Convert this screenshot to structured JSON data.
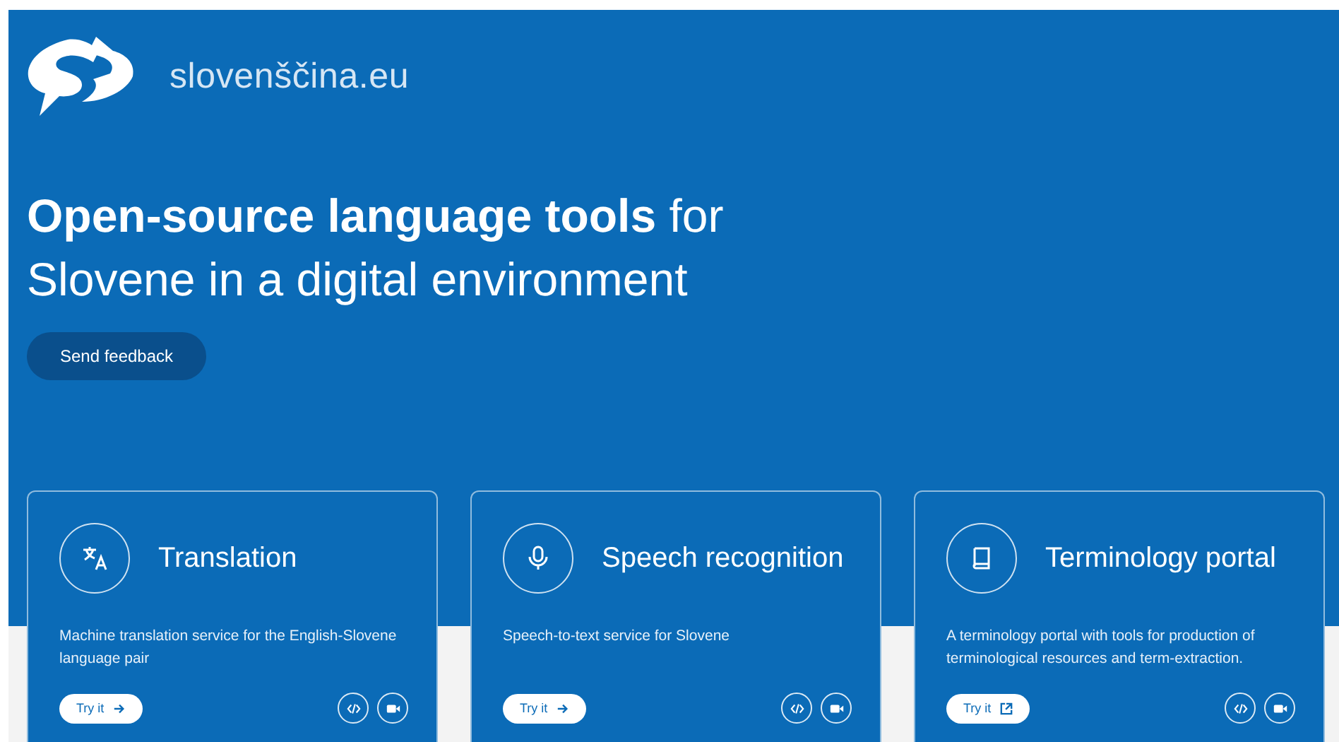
{
  "brand": {
    "name": "slovenščina.eu"
  },
  "hero": {
    "headline": "**Open-source language tools** for Slovene in a digital environment",
    "button": "Send feedback"
  },
  "cards": [
    {
      "kind": "internal",
      "title": "Translation",
      "description": "Machine translation service for the English-Slovene language pair",
      "try_label": "Try it"
    },
    {
      "kind": "internal",
      "title": "Speech recognition",
      "description": "Speech-to-text service for Slovene",
      "try_label": "Try it"
    },
    {
      "kind": "external",
      "title": "Terminology portal",
      "description": "A terminology portal with tools for production of terminological resources and term-extraction.",
      "try_label": "Try it"
    }
  ]
}
